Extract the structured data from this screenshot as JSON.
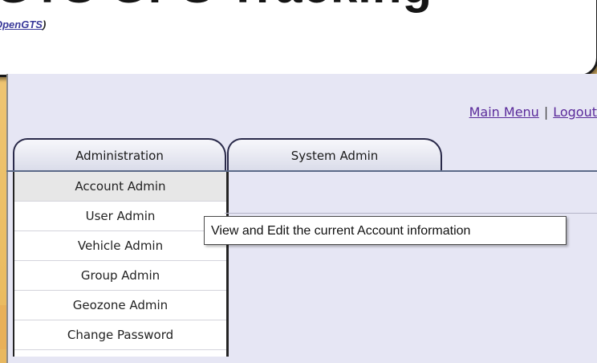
{
  "header": {
    "title": "GTS GPS Tracking",
    "subtitle_link": "OpenGTS",
    "subtitle_suffix": ")"
  },
  "topnav": {
    "main_menu": "Main Menu",
    "separator": "|",
    "logout": "Logout"
  },
  "tabs": [
    {
      "label": "Administration",
      "active": true
    },
    {
      "label": "System Admin",
      "active": false
    }
  ],
  "menu": {
    "items": [
      {
        "label": "Account Admin",
        "active": true
      },
      {
        "label": "User Admin"
      },
      {
        "label": "Vehicle Admin"
      },
      {
        "label": "Group Admin"
      },
      {
        "label": "Geozone Admin"
      },
      {
        "label": "Change Password"
      }
    ]
  },
  "tooltip": {
    "text": "View and Edit the current Account information"
  },
  "colors": {
    "background": "#e9b95c",
    "panel": "#e6e6f4",
    "link": "#5a2a9a"
  }
}
